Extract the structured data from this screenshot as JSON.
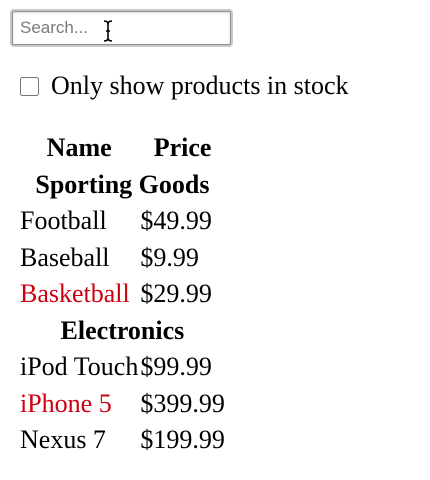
{
  "search": {
    "placeholder": "Search...",
    "value": ""
  },
  "stock_filter": {
    "label": "Only show products in stock",
    "checked": false
  },
  "table": {
    "headers": {
      "name": "Name",
      "price": "Price"
    },
    "categories": [
      {
        "name": "Sporting Goods",
        "products": [
          {
            "name": "Football",
            "price": "$49.99",
            "stocked": true
          },
          {
            "name": "Baseball",
            "price": "$9.99",
            "stocked": true
          },
          {
            "name": "Basketball",
            "price": "$29.99",
            "stocked": false
          }
        ]
      },
      {
        "name": "Electronics",
        "products": [
          {
            "name": "iPod Touch",
            "price": "$99.99",
            "stocked": true
          },
          {
            "name": "iPhone 5",
            "price": "$399.99",
            "stocked": false
          },
          {
            "name": "Nexus 7",
            "price": "$199.99",
            "stocked": true
          }
        ]
      }
    ]
  },
  "colors": {
    "out_of_stock": "#cc0010"
  },
  "icons": {
    "cursor": "text-cursor-icon"
  }
}
